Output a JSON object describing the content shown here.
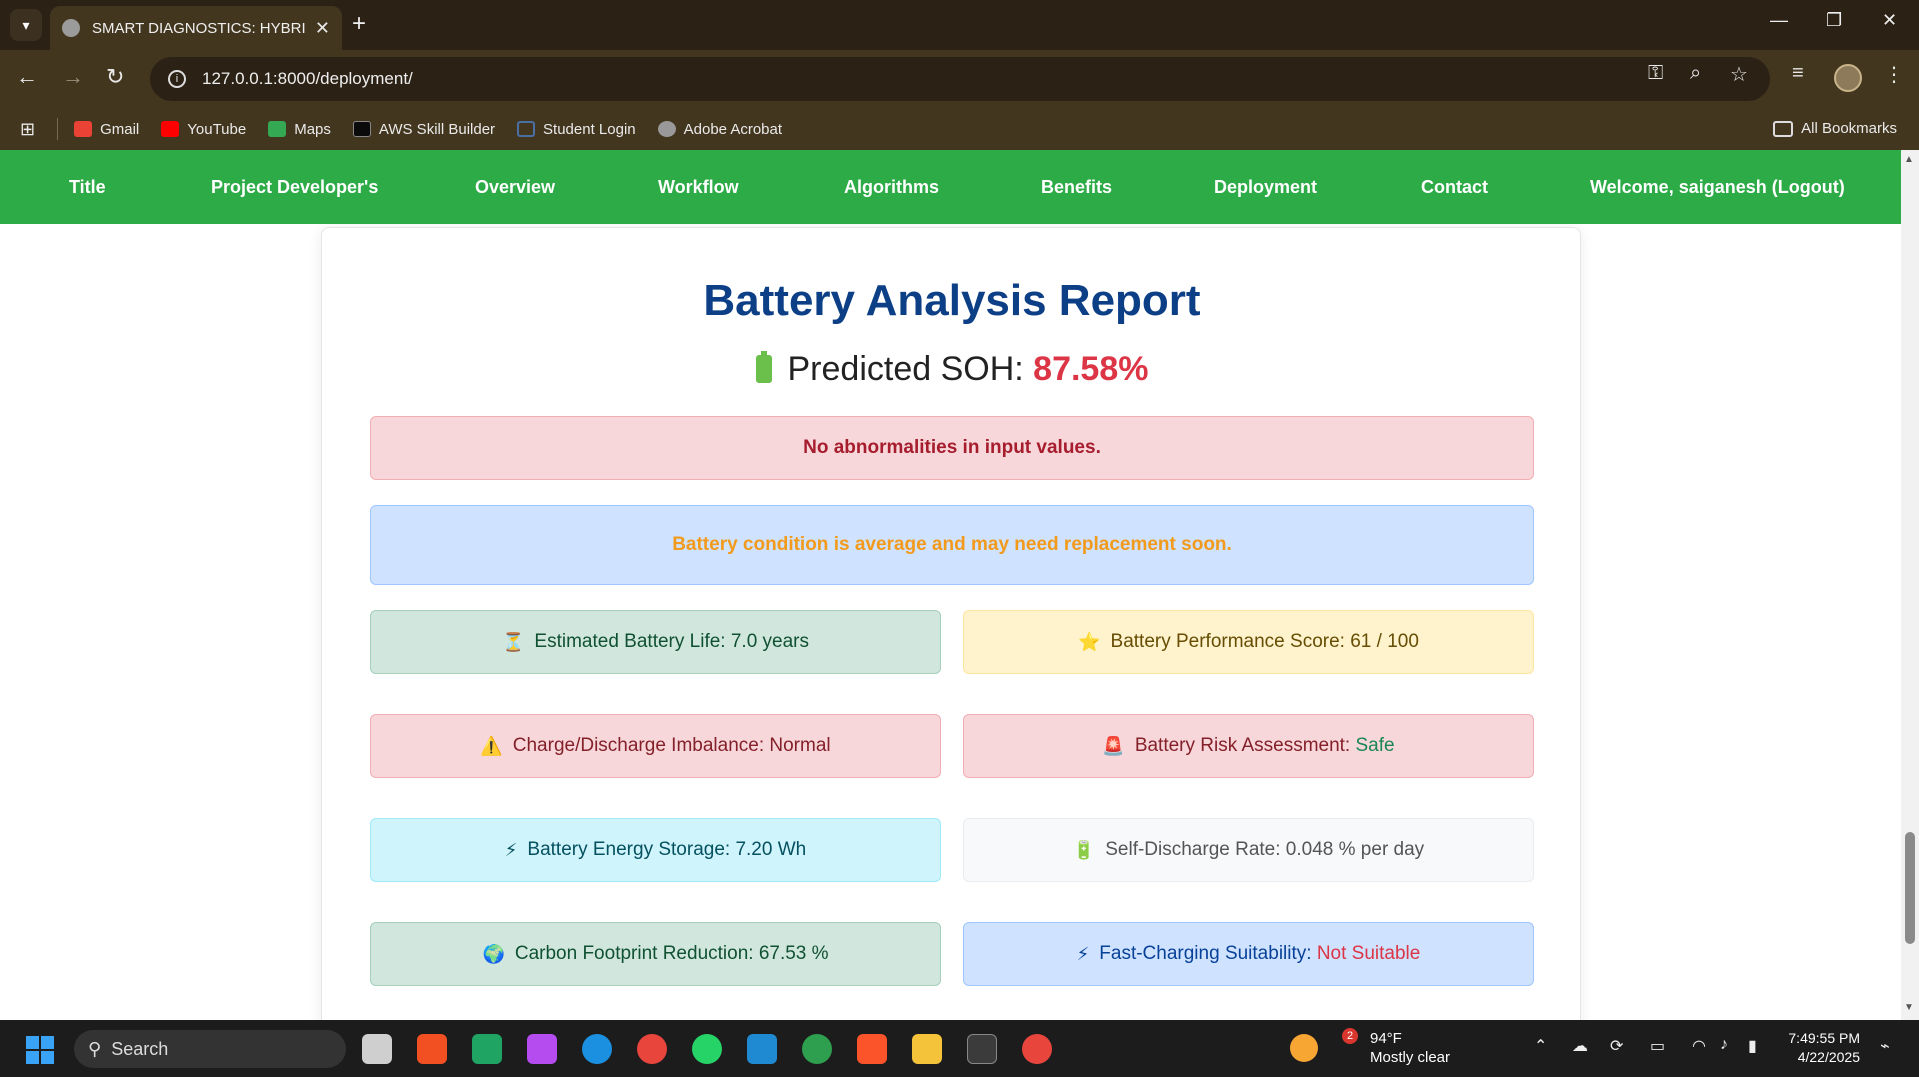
{
  "browser": {
    "tab_title": "SMART DIAGNOSTICS: HYBRID",
    "url": "127.0.0.1:8000/deployment/",
    "bookmarks": [
      {
        "label": "Gmail",
        "color": "#ea4335"
      },
      {
        "label": "YouTube",
        "color": "#ff0000"
      },
      {
        "label": "Maps",
        "color": "#34a853"
      },
      {
        "label": "AWS Skill Builder",
        "color": "#232f3e"
      },
      {
        "label": "Student Login",
        "color": "#4a6fa5"
      },
      {
        "label": "Adobe Acrobat",
        "color": "#999999"
      }
    ],
    "all_bookmarks": "All Bookmarks"
  },
  "nav": {
    "items": [
      "Title",
      "Project Developer's",
      "Overview",
      "Workflow",
      "Algorithms",
      "Benefits",
      "Deployment",
      "Contact",
      "Welcome, saiganesh (Logout)"
    ],
    "color": "#2dab47"
  },
  "report": {
    "title": "Battery Analysis Report",
    "soh_label": "Predicted SOH:",
    "soh_value": "87.58%",
    "abnormality_msg": "No abnormalities in input values.",
    "condition_msg": "Battery condition is average and may need replacement soon.",
    "metrics": {
      "life": {
        "icon": "⏳",
        "label": "Estimated Battery Life: 7.0 years"
      },
      "score": {
        "icon": "⭐",
        "label": "Battery Performance Score: 61 / 100"
      },
      "imbalance": {
        "icon": "⚠️",
        "label": "Charge/Discharge Imbalance: Normal"
      },
      "risk": {
        "icon": "🚨",
        "label": "Battery Risk Assessment:",
        "value": "Safe"
      },
      "energy": {
        "icon": "⚡",
        "label": "Battery Energy Storage: 7.20 Wh"
      },
      "selfdischarge": {
        "icon": "🔋",
        "label": "Self-Discharge Rate: 0.048 % per day"
      },
      "carbon": {
        "icon": "🌍",
        "label": "Carbon Footprint Reduction: 67.53 %"
      },
      "fastcharge": {
        "icon": "⚡",
        "label": "Fast-Charging Suitability:",
        "value": "Not Suitable"
      }
    }
  },
  "taskbar": {
    "search_placeholder": "Search",
    "weather_temp": "94°F",
    "weather_desc": "Mostly clear",
    "weather_badge": "2",
    "time": "7:49:55 PM",
    "date": "4/22/2025"
  }
}
